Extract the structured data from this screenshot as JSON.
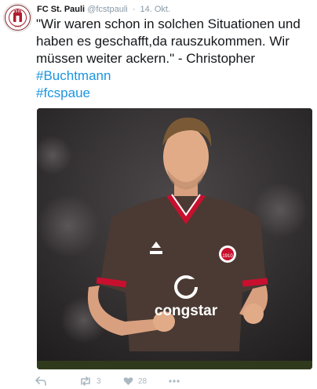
{
  "account": {
    "name": "FC St. Pauli",
    "handle": "@fcstpauli",
    "separator": "·",
    "date": "14. Okt.",
    "avatar_text": "F.C. ST. PAULI 1910"
  },
  "tweet": {
    "text_main": "\"Wir waren schon in solchen Situationen und haben es geschafft,da rauszukommen. Wir müssen weiter ackern.\" - Christopher ",
    "hashtag_1": "#Buchtmann",
    "hashtag_2": "#fcspaue"
  },
  "media": {
    "sponsor_text": "congstar",
    "crest_text": "1910"
  },
  "actions": {
    "retweets": "3",
    "likes": "28"
  },
  "colors": {
    "link": "#1b95e0",
    "muted": "#8899a6",
    "action_icon": "#aab8c2",
    "jersey": "#4a3a33",
    "collar": "#c8102e"
  },
  "icons": [
    "reply-icon",
    "retweet-icon",
    "like-icon",
    "more-icon",
    "fcsp-crest-icon"
  ]
}
